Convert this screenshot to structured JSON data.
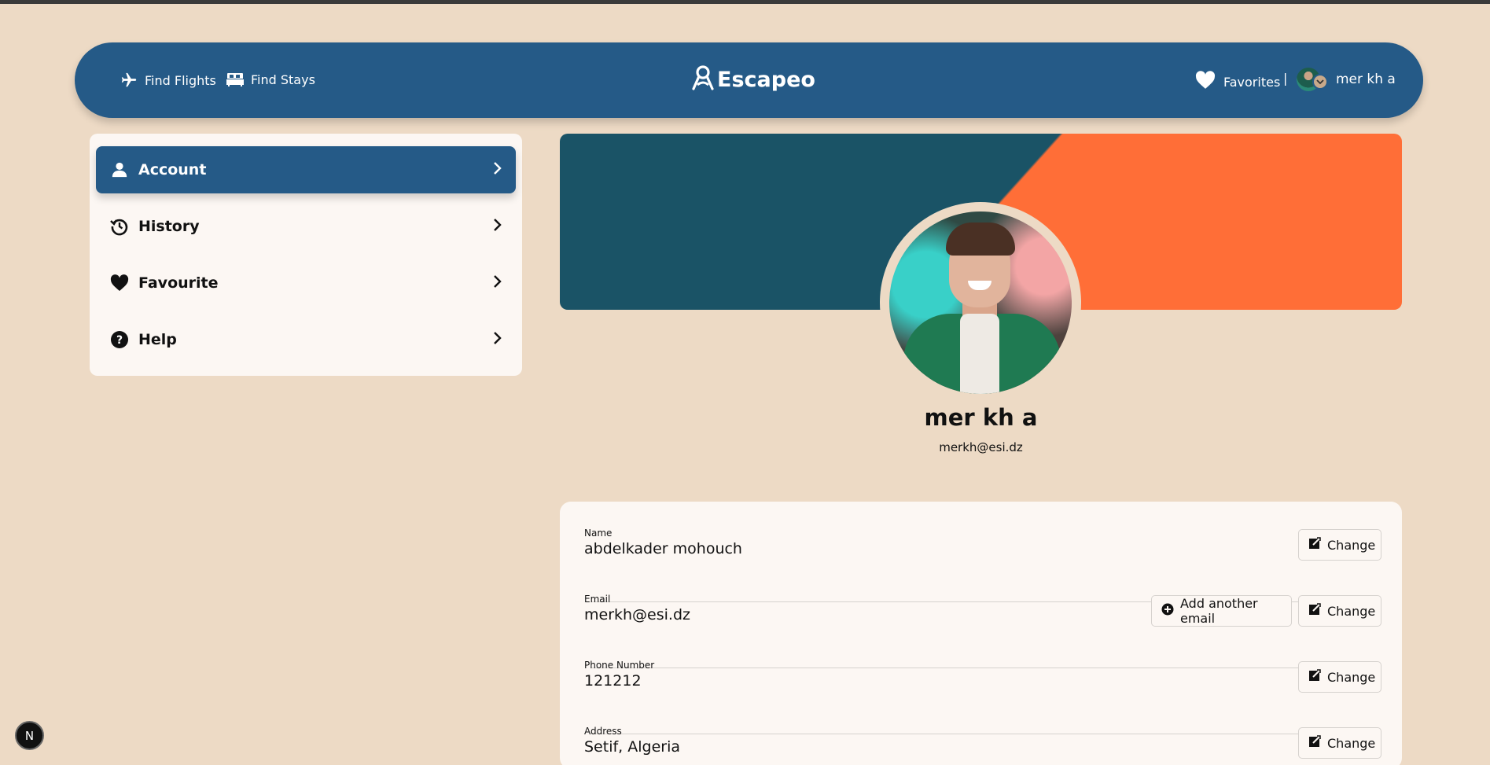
{
  "header": {
    "nav": [
      {
        "label": "Find Flights",
        "icon": "airplane-icon"
      },
      {
        "label": "Find Stays",
        "icon": "bed-icon"
      }
    ],
    "logo_text": "Escapeo",
    "favorites_label": "Favorites",
    "separator": "|",
    "user_name": "mer kh a"
  },
  "sidebar": {
    "items": [
      {
        "label": "Account",
        "icon": "user-icon",
        "active": true
      },
      {
        "label": "History",
        "icon": "history-icon",
        "active": false
      },
      {
        "label": "Favourite",
        "icon": "heart-icon",
        "active": false
      },
      {
        "label": "Help",
        "icon": "help-icon",
        "active": false
      }
    ]
  },
  "profile": {
    "name": "mer kh a",
    "email": "merkh@esi.dz"
  },
  "details": {
    "fields": [
      {
        "label": "Name",
        "value": "abdelkader mohouch"
      },
      {
        "label": "Email",
        "value": "merkh@esi.dz"
      },
      {
        "label": "Phone Number",
        "value": "121212"
      },
      {
        "label": "Address",
        "value": "Setif, Algeria"
      }
    ],
    "change_label": "Change",
    "add_email_label": "Add another email"
  },
  "badge": "N",
  "colors": {
    "background": "#eddac5",
    "primary": "#255a87",
    "cover_dark": "#1a5366",
    "cover_orange": "#ff6e37",
    "card": "#fcf7f3"
  }
}
